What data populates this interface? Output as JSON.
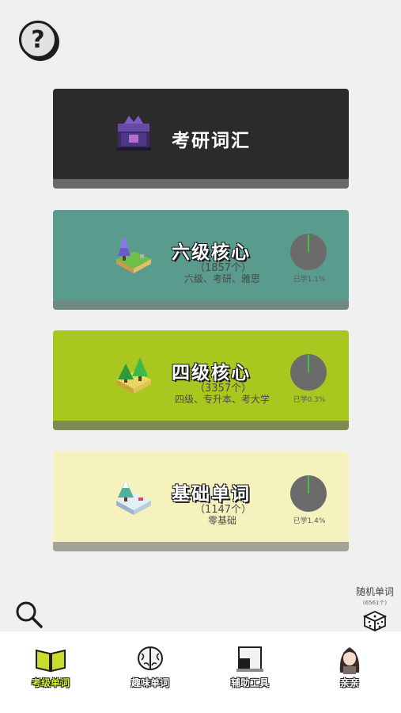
{
  "help": {
    "icon": "?"
  },
  "cards": [
    {
      "title": "考研词汇"
    },
    {
      "title": "六级核心",
      "count": "（1857个）",
      "tags": "六级、考研、雅思",
      "progress_label": "已学1.1%",
      "progress": 0.011
    },
    {
      "title": "四级核心",
      "count": "（3357个）",
      "tags": "四级、专升本、考大学",
      "progress_label": "已学0.3%",
      "progress": 0.003
    },
    {
      "title": "基础单词",
      "count": "（1147个）",
      "tags": "零基础",
      "progress_label": "已学1.4%",
      "progress": 0.014
    }
  ],
  "random": {
    "label": "随机单词",
    "sub": "(6561个)",
    "icon": "dice-icon"
  },
  "search": {
    "icon": "search-icon"
  },
  "tabs": [
    {
      "label": "考级单词",
      "icon": "book-icon",
      "active": true
    },
    {
      "label": "趣味单词",
      "icon": "brain-icon",
      "active": false
    },
    {
      "label": "辅助工具",
      "icon": "tool-icon",
      "active": false
    },
    {
      "label": "亲亲",
      "icon": "avatar-icon",
      "active": false
    }
  ],
  "colors": {
    "kaoyan": "#2c2b2b",
    "cet6": "#599b8c",
    "cet4": "#a8c820",
    "basic": "#f6f2bd",
    "active_tab": "#d4e836",
    "progress_slice": "#3fc03f"
  }
}
